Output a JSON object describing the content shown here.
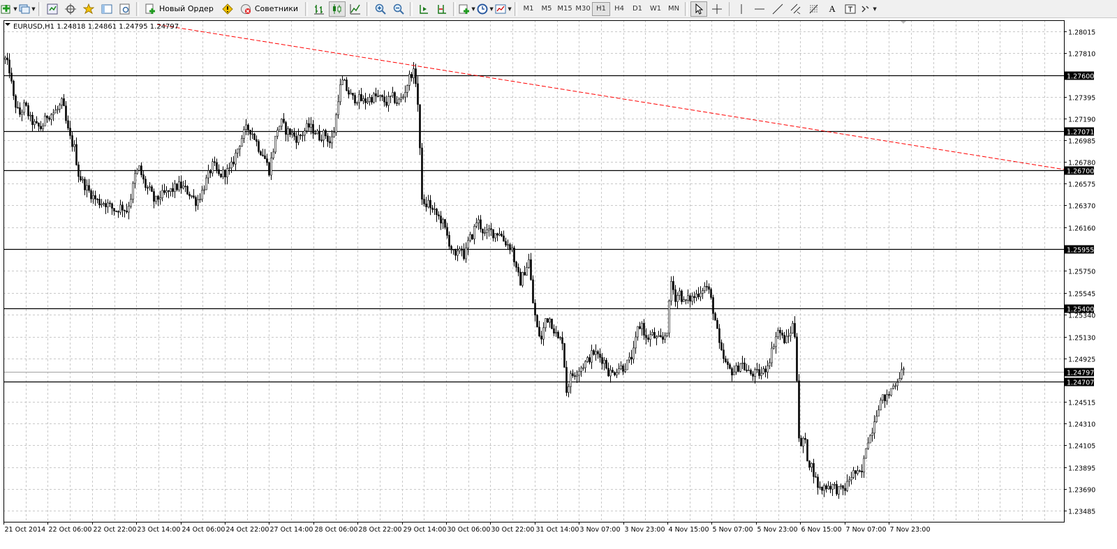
{
  "toolbar": {
    "new_order_label": "Новый Ордер",
    "advisors_label": "Советники",
    "timeframes": [
      {
        "label": "M1",
        "active": false
      },
      {
        "label": "M5",
        "active": false
      },
      {
        "label": "M15",
        "active": false
      },
      {
        "label": "M30",
        "active": false
      },
      {
        "label": "H1",
        "active": true
      },
      {
        "label": "H4",
        "active": false
      },
      {
        "label": "D1",
        "active": false
      },
      {
        "label": "W1",
        "active": false
      },
      {
        "label": "MN",
        "active": false
      }
    ],
    "icons": [
      "new-chart-icon",
      "profiles-icon",
      "market-watch-icon",
      "crosshair-navigator-icon",
      "favorites-icon",
      "data-window-icon",
      "tester-icon",
      "new-order-icon",
      "autotrading-warning-icon",
      "advisors-icon",
      "bar-chart-icon",
      "candlestick-icon",
      "line-chart-icon",
      "zoom-in-icon",
      "zoom-out-icon",
      "autoscroll-icon",
      "chart-shift-icon",
      "indicators-icon",
      "periods-icon",
      "templates-icon",
      "cursor-icon",
      "crosshair-icon",
      "vertical-line-icon",
      "horizontal-line-icon",
      "trendline-icon",
      "equidistant-channel-icon",
      "fibonacci-icon",
      "text-icon",
      "text-label-icon",
      "arrows-icon"
    ],
    "text_tool_label": "A"
  },
  "chart_data": {
    "type": "candlestick",
    "symbol_header": "EURUSD,H1  1.24818 1.24861 1.24795 1.24797",
    "ylim": [
      1.2338,
      1.2812
    ],
    "y_ticks": [
      "1.28015",
      "1.27810",
      "1.27395",
      "1.27190",
      "1.26985",
      "1.26780",
      "1.26575",
      "1.26370",
      "1.26160",
      "1.25750",
      "1.25545",
      "1.25340",
      "1.25130",
      "1.24925",
      "1.24515",
      "1.24310",
      "1.24105",
      "1.23895",
      "1.23690",
      "1.23485"
    ],
    "x_ticks": [
      "21 Oct 2014",
      "22 Oct 06:00",
      "22 Oct 22:00",
      "23 Oct 14:00",
      "24 Oct 06:00",
      "24 Oct 22:00",
      "27 Oct 14:00",
      "28 Oct 06:00",
      "28 Oct 22:00",
      "29 Oct 14:00",
      "30 Oct 06:00",
      "30 Oct 22:00",
      "31 Oct 14:00",
      "3 Nov 07:00",
      "3 Nov 23:00",
      "4 Nov 15:00",
      "5 Nov 07:00",
      "5 Nov 23:00",
      "6 Nov 15:00",
      "7 Nov 07:00",
      "7 Nov 23:00"
    ],
    "horizontal_levels": [
      {
        "label": "1.27600",
        "value": 1.276
      },
      {
        "label": "1.27071",
        "value": 1.27071
      },
      {
        "label": "1.26700",
        "value": 1.267
      },
      {
        "label": "1.25955",
        "value": 1.25955
      },
      {
        "label": "1.25400",
        "value": 1.254
      },
      {
        "label": "1.24707",
        "value": 1.24707
      }
    ],
    "bid_line": {
      "label": "1.24797",
      "value": 1.24797
    },
    "trendline": {
      "color": "#ff0000",
      "from": {
        "x": "21 Oct 2014",
        "y": 1.2808
      },
      "to": {
        "x": "7 Nov 23:00",
        "y": 1.2671
      }
    },
    "path": [
      [
        0,
        1.2775
      ],
      [
        6,
        1.2765
      ],
      [
        12,
        1.2738
      ],
      [
        20,
        1.2722
      ],
      [
        28,
        1.2732
      ],
      [
        36,
        1.2718
      ],
      [
        44,
        1.2712
      ],
      [
        52,
        1.271
      ],
      [
        60,
        1.2722
      ],
      [
        68,
        1.2724
      ],
      [
        76,
        1.2728
      ],
      [
        82,
        1.2735
      ],
      [
        88,
        1.2712
      ],
      [
        94,
        1.2698
      ],
      [
        100,
        1.269
      ],
      [
        104,
        1.2668
      ],
      [
        110,
        1.266
      ],
      [
        118,
        1.2652
      ],
      [
        126,
        1.2645
      ],
      [
        134,
        1.264
      ],
      [
        142,
        1.264
      ],
      [
        150,
        1.2636
      ],
      [
        158,
        1.2632
      ],
      [
        166,
        1.2636
      ],
      [
        174,
        1.2632
      ],
      [
        180,
        1.2645
      ],
      [
        186,
        1.2665
      ],
      [
        192,
        1.2672
      ],
      [
        200,
        1.2656
      ],
      [
        208,
        1.265
      ],
      [
        214,
        1.264
      ],
      [
        222,
        1.2646
      ],
      [
        230,
        1.2648
      ],
      [
        240,
        1.2652
      ],
      [
        250,
        1.2656
      ],
      [
        258,
        1.2652
      ],
      [
        266,
        1.2647
      ],
      [
        274,
        1.264
      ],
      [
        282,
        1.265
      ],
      [
        290,
        1.2664
      ],
      [
        298,
        1.2676
      ],
      [
        306,
        1.2665
      ],
      [
        314,
        1.2668
      ],
      [
        322,
        1.267
      ],
      [
        330,
        1.2685
      ],
      [
        338,
        1.27
      ],
      [
        346,
        1.271
      ],
      [
        352,
        1.2708
      ],
      [
        358,
        1.27
      ],
      [
        364,
        1.269
      ],
      [
        370,
        1.2685
      ],
      [
        378,
        1.267
      ],
      [
        384,
        1.269
      ],
      [
        390,
        1.271
      ],
      [
        396,
        1.2715
      ],
      [
        402,
        1.2708
      ],
      [
        410,
        1.2705
      ],
      [
        418,
        1.27
      ],
      [
        426,
        1.2705
      ],
      [
        434,
        1.2712
      ],
      [
        442,
        1.2708
      ],
      [
        450,
        1.2702
      ],
      [
        458,
        1.2705
      ],
      [
        466,
        1.2695
      ],
      [
        472,
        1.271
      ],
      [
        478,
        1.2745
      ],
      [
        484,
        1.2755
      ],
      [
        490,
        1.2745
      ],
      [
        498,
        1.2738
      ],
      [
        506,
        1.2738
      ],
      [
        514,
        1.2735
      ],
      [
        522,
        1.2738
      ],
      [
        530,
        1.274
      ],
      [
        538,
        1.2738
      ],
      [
        546,
        1.2734
      ],
      [
        554,
        1.274
      ],
      [
        562,
        1.2734
      ],
      [
        570,
        1.274
      ],
      [
        576,
        1.2752
      ],
      [
        580,
        1.276
      ],
      [
        584,
        1.2764
      ],
      [
        588,
        1.2755
      ],
      [
        592,
        1.2725
      ],
      [
        596,
        1.265
      ],
      [
        600,
        1.2635
      ],
      [
        606,
        1.264
      ],
      [
        612,
        1.2632
      ],
      [
        618,
        1.2628
      ],
      [
        626,
        1.2622
      ],
      [
        632,
        1.261
      ],
      [
        638,
        1.2598
      ],
      [
        646,
        1.2585
      ],
      [
        652,
        1.26
      ],
      [
        658,
        1.2588
      ],
      [
        664,
        1.2604
      ],
      [
        670,
        1.261
      ],
      [
        676,
        1.2624
      ],
      [
        682,
        1.2616
      ],
      [
        688,
        1.2608
      ],
      [
        694,
        1.2614
      ],
      [
        700,
        1.261
      ],
      [
        708,
        1.2612
      ],
      [
        714,
        1.2604
      ],
      [
        720,
        1.26
      ],
      [
        726,
        1.2596
      ],
      [
        732,
        1.2575
      ],
      [
        738,
        1.2565
      ],
      [
        744,
        1.2575
      ],
      [
        750,
        1.2585
      ],
      [
        756,
        1.2545
      ],
      [
        762,
        1.252
      ],
      [
        768,
        1.251
      ],
      [
        774,
        1.253
      ],
      [
        780,
        1.253
      ],
      [
        786,
        1.252
      ],
      [
        792,
        1.251
      ],
      [
        798,
        1.251
      ],
      [
        804,
        1.2462
      ],
      [
        810,
        1.2475
      ],
      [
        818,
        1.248
      ],
      [
        826,
        1.2485
      ],
      [
        834,
        1.249
      ],
      [
        842,
        1.2498
      ],
      [
        850,
        1.2495
      ],
      [
        858,
        1.249
      ],
      [
        864,
        1.248
      ],
      [
        870,
        1.2478
      ],
      [
        878,
        1.2484
      ],
      [
        886,
        1.2484
      ],
      [
        894,
        1.249
      ],
      [
        900,
        1.2498
      ],
      [
        906,
        1.252
      ],
      [
        912,
        1.2525
      ],
      [
        918,
        1.251
      ],
      [
        926,
        1.2515
      ],
      [
        934,
        1.251
      ],
      [
        942,
        1.251
      ],
      [
        948,
        1.252
      ],
      [
        954,
        1.2565
      ],
      [
        960,
        1.255
      ],
      [
        966,
        1.2555
      ],
      [
        972,
        1.2545
      ],
      [
        978,
        1.2548
      ],
      [
        986,
        1.255
      ],
      [
        994,
        1.2555
      ],
      [
        1000,
        1.256
      ],
      [
        1006,
        1.256
      ],
      [
        1012,
        1.2545
      ],
      [
        1018,
        1.2525
      ],
      [
        1024,
        1.25
      ],
      [
        1030,
        1.249
      ],
      [
        1036,
        1.2482
      ],
      [
        1042,
        1.248
      ],
      [
        1048,
        1.2482
      ],
      [
        1054,
        1.249
      ],
      [
        1060,
        1.2482
      ],
      [
        1066,
        1.2478
      ],
      [
        1072,
        1.2478
      ],
      [
        1078,
        1.2478
      ],
      [
        1084,
        1.2478
      ],
      [
        1090,
        1.2484
      ],
      [
        1096,
        1.2494
      ],
      [
        1102,
        1.251
      ],
      [
        1108,
        1.252
      ],
      [
        1114,
        1.251
      ],
      [
        1120,
        1.251
      ],
      [
        1126,
        1.252
      ],
      [
        1130,
        1.2528
      ],
      [
        1134,
        1.2475
      ],
      [
        1138,
        1.24
      ],
      [
        1144,
        1.242
      ],
      [
        1150,
        1.2395
      ],
      [
        1156,
        1.239
      ],
      [
        1162,
        1.2375
      ],
      [
        1168,
        1.2368
      ],
      [
        1174,
        1.2372
      ],
      [
        1180,
        1.2372
      ],
      [
        1186,
        1.2372
      ],
      [
        1192,
        1.2368
      ],
      [
        1198,
        1.2368
      ],
      [
        1204,
        1.237
      ],
      [
        1210,
        1.238
      ],
      [
        1216,
        1.2385
      ],
      [
        1222,
        1.2382
      ],
      [
        1228,
        1.2385
      ],
      [
        1234,
        1.2415
      ],
      [
        1240,
        1.242
      ],
      [
        1246,
        1.2438
      ],
      [
        1252,
        1.245
      ],
      [
        1258,
        1.2455
      ],
      [
        1264,
        1.2455
      ],
      [
        1270,
        1.2465
      ],
      [
        1276,
        1.247
      ],
      [
        1282,
        1.2478
      ],
      [
        1288,
        1.248
      ]
    ]
  }
}
